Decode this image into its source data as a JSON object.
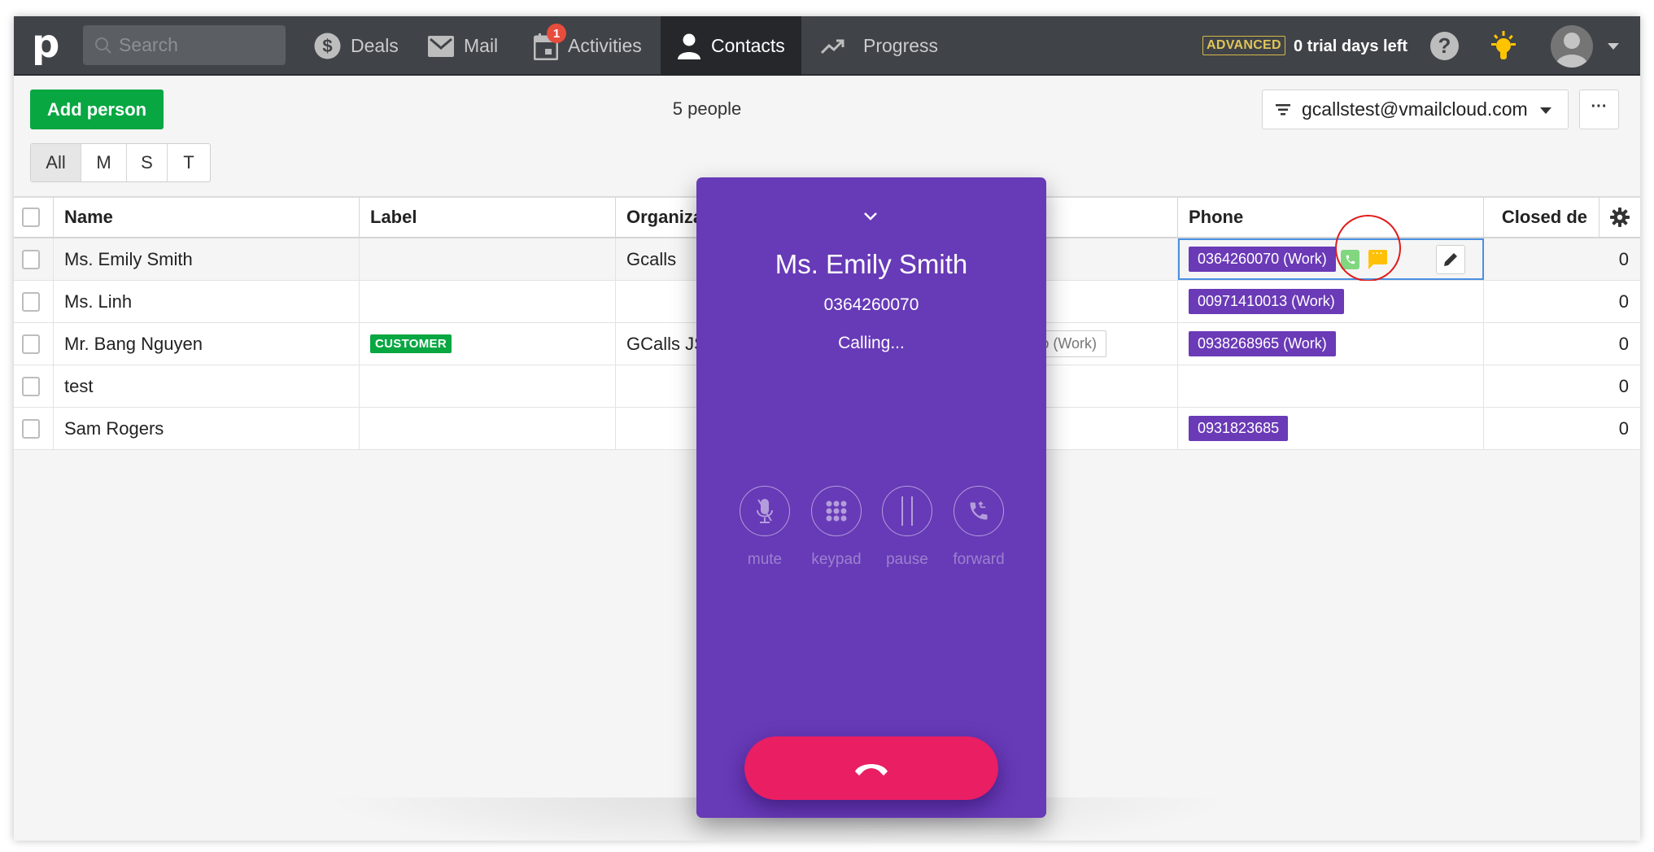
{
  "nav": {
    "logo": "p",
    "search_placeholder": "Search",
    "items": [
      {
        "label": "Deals",
        "icon": "dollar-icon"
      },
      {
        "label": "Mail",
        "icon": "mail-icon"
      },
      {
        "label": "Activities",
        "icon": "calendar-icon",
        "badge": "1"
      },
      {
        "label": "Contacts",
        "icon": "person-icon",
        "active": true
      },
      {
        "label": "Progress",
        "icon": "trend-icon"
      }
    ],
    "plan_badge": "ADVANCED",
    "trial_text": "0 trial days left",
    "help_label": "?"
  },
  "toolbar": {
    "add_label": "Add person",
    "count_text": "5 people",
    "filter_value": "gcallstest@vmailcloud.com",
    "more_label": "···",
    "letters": [
      {
        "label": "All",
        "active": true
      },
      {
        "label": "M"
      },
      {
        "label": "S"
      },
      {
        "label": "T"
      }
    ]
  },
  "table": {
    "columns": [
      "Name",
      "Label",
      "Organiza",
      "",
      "Phone",
      "Closed de"
    ],
    "rows": [
      {
        "name": "Ms. Emily Smith",
        "label": "",
        "org": "Gcalls",
        "email": "",
        "phone": "0364260070 (Work)",
        "closed": "0"
      },
      {
        "name": "Ms. Linh",
        "label": "",
        "org": "",
        "email": "",
        "phone": "00971410013 (Work)",
        "closed": "0"
      },
      {
        "name": "Mr. Bang Nguyen",
        "label": "CUSTOMER",
        "org": "GCalls JS",
        "email": "o (Work)",
        "phone": "0938268965 (Work)",
        "closed": "0"
      },
      {
        "name": "test",
        "label": "",
        "org": "",
        "email": "",
        "phone": "",
        "closed": "0"
      },
      {
        "name": "Sam Rogers",
        "label": "",
        "org": "",
        "email": "",
        "phone": "0931823685",
        "closed": "0"
      }
    ],
    "sms_dots": "···"
  },
  "call": {
    "contact_name": "Ms. Emily Smith",
    "number": "0364260070",
    "status": "Calling...",
    "controls": [
      {
        "label": "mute",
        "icon": "mute-icon"
      },
      {
        "label": "keypad",
        "icon": "keypad-icon"
      },
      {
        "label": "pause",
        "icon": "pause-icon"
      },
      {
        "label": "forward",
        "icon": "forward-icon"
      }
    ]
  },
  "colors": {
    "nav_bg": "#404347",
    "accent_green": "#08a742",
    "phone_tag": "#6a3ab7",
    "popup_bg": "#673ab7",
    "hangup": "#e91e63",
    "highlight_circle": "#e01b1b"
  }
}
